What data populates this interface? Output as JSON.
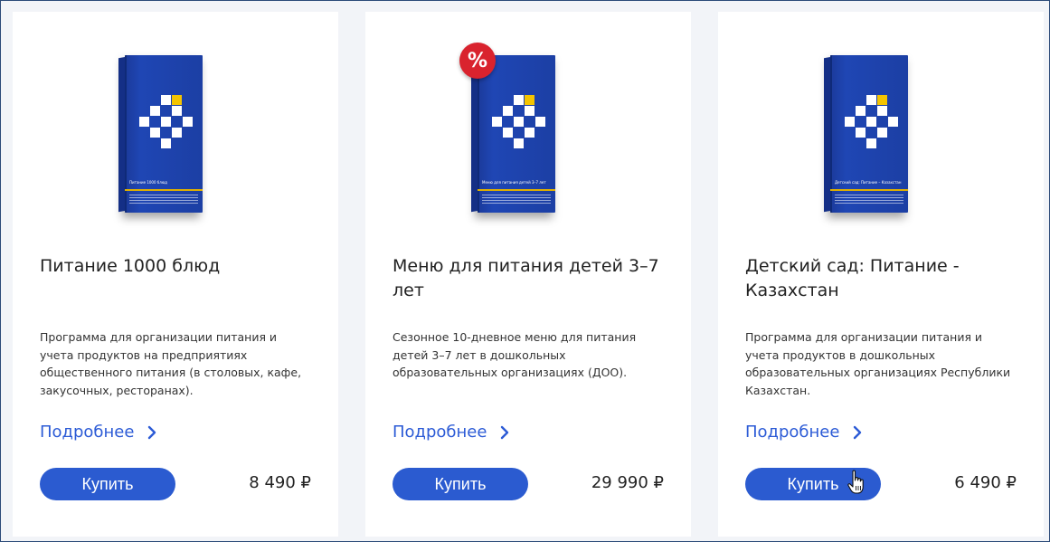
{
  "products": [
    {
      "name": "Питание 1000 блюд",
      "description": "Программа для организации питания и учета продуктов на предприятиях общественного питания (в столовых, кафе, закусочных, ресторанах).",
      "box_title": "Питание 1000 блюд",
      "more_label": "Подробнее",
      "buy_label": "Купить",
      "price": "8 490 ₽",
      "sale": false
    },
    {
      "name": "Меню для питания детей 3–7 лет",
      "description": "Сезонное 10-дневное меню для питания детей 3–7 лет в дошкольных образовательных организациях (ДОО).",
      "box_title": "Меню для питания детей 3–7 лет",
      "more_label": "Подробнее",
      "buy_label": "Купить",
      "price": "29 990 ₽",
      "sale": true,
      "sale_badge": "%"
    },
    {
      "name": "Детский сад: Питание - Казахстан",
      "description": "Программа для организации питания и учета продуктов в дошкольных образовательных организациях Республики Казахстан.",
      "box_title": "Детский сад: Питание – Казахстан",
      "more_label": "Подробнее",
      "buy_label": "Купить",
      "price": "6 490 ₽",
      "sale": false
    }
  ],
  "colors": {
    "accent": "#2b5bd0",
    "link": "#2c5bd6",
    "box_blue": "#1c3fa4",
    "box_yellow": "#f4c400",
    "sale_red": "#d9232e"
  },
  "icons": [
    "chevron-right-icon",
    "hand-pointer-icon"
  ]
}
